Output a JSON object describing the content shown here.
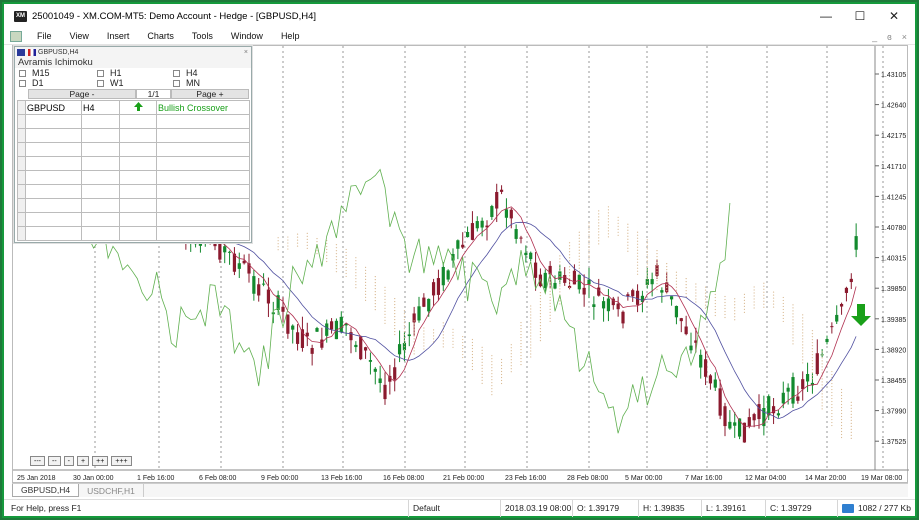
{
  "window": {
    "title": "25001049 - XM.COM-MT5: Demo Account - Hedge - [GBPUSD,H4]",
    "app_icon_text": "XM",
    "minimize": "—",
    "maximize": "☐",
    "close": "✕"
  },
  "menu": {
    "items": [
      "File",
      "View",
      "Insert",
      "Charts",
      "Tools",
      "Window",
      "Help"
    ],
    "mdi_min": "_",
    "mdi_restore": "ɞ",
    "mdi_close": "×"
  },
  "panel": {
    "symbol_label": "GBPUSD,H4",
    "close": "×",
    "title": "Avramis Ichimoku",
    "timeframes": [
      "M15",
      "H1",
      "H4",
      "D1",
      "W1",
      "MN"
    ],
    "page_prev": "Page -",
    "page_indicator": "1/1",
    "page_next": "Page +",
    "signals": [
      {
        "symbol": "GBPUSD",
        "timeframe": "H4",
        "direction": "up",
        "signal": "Bullish Crossover"
      }
    ],
    "empty_rows": 9
  },
  "chart": {
    "symbol": "GBPUSD",
    "timeframe": "H4",
    "price_labels": [
      "1.43105",
      "1.42640",
      "1.42175",
      "1.41710",
      "1.41245",
      "1.40780",
      "1.40315",
      "1.39850",
      "1.39385",
      "1.38920",
      "1.38455",
      "1.37990",
      "1.37525"
    ],
    "time_labels": [
      "25 Jan 2018",
      "30 Jan 00:00",
      "1 Feb 16:00",
      "6 Feb 08:00",
      "9 Feb 00:00",
      "13 Feb 16:00",
      "16 Feb 08:00",
      "21 Feb 00:00",
      "23 Feb 16:00",
      "28 Feb 08:00",
      "5 Mar 00:00",
      "7 Mar 16:00",
      "12 Mar 04:00",
      "14 Mar 20:00",
      "19 Mar 08:00"
    ],
    "colors": {
      "bull": "#138a2e",
      "bear": "#8b1a2e",
      "tenkan": "#b03050",
      "kijun": "#5050a0",
      "chikou": "#60b050",
      "cloud": "#d8b890"
    },
    "zoom_buttons": [
      "---",
      "--",
      "-",
      "+",
      "++",
      "+++"
    ]
  },
  "tabs": [
    {
      "label": "GBPUSD,H4",
      "active": true
    },
    {
      "label": "USDCHF,H1",
      "active": false
    }
  ],
  "status": {
    "help": "For Help, press F1",
    "profile": "Default",
    "datetime": "2018.03.19 08:00",
    "open": "O: 1.39179",
    "high": "H: 1.39835",
    "low": "L: 1.39161",
    "close": "C: 1.39729",
    "traffic": "1082 / 277 Kb"
  }
}
